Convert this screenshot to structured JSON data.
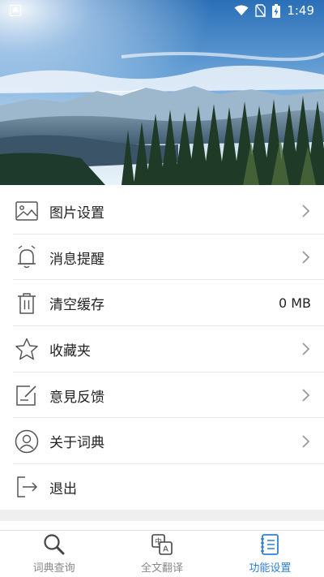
{
  "status_bar": {
    "time": "1:49",
    "notification_icon": "A"
  },
  "menu": {
    "items": [
      {
        "label": "图片设置",
        "icon": "image-icon",
        "value": ""
      },
      {
        "label": "消息提醒",
        "icon": "bell-icon",
        "value": ""
      },
      {
        "label": "清空缓存",
        "icon": "trash-icon",
        "value": "0 MB"
      },
      {
        "label": "收藏夹",
        "icon": "star-icon",
        "value": ""
      },
      {
        "label": "意見反馈",
        "icon": "feedback-icon",
        "value": ""
      },
      {
        "label": "关于词典",
        "icon": "user-circle-icon",
        "value": ""
      },
      {
        "label": "退出",
        "icon": "logout-icon",
        "value": ""
      }
    ]
  },
  "tabbar": {
    "tabs": [
      {
        "label": "词典查询",
        "icon": "search-icon",
        "active": false
      },
      {
        "label": "全文翻译",
        "icon": "translate-icon",
        "active": false
      },
      {
        "label": "功能设置",
        "icon": "settings-notebook-icon",
        "active": true
      }
    ]
  },
  "colors": {
    "accent": "#2f80d4",
    "text": "#222222",
    "icon": "#555555",
    "divider": "#e8e8e8"
  }
}
